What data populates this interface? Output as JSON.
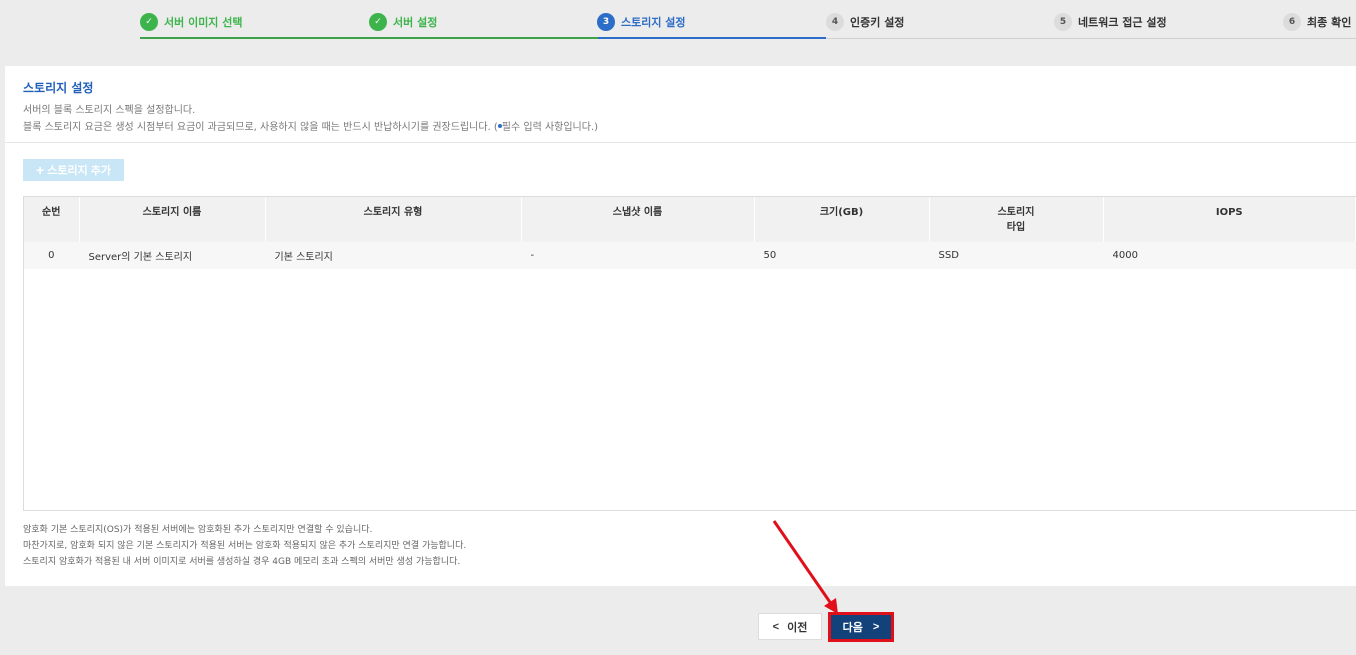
{
  "stepper": {
    "steps": [
      {
        "num": "✓",
        "label": "서버 이미지 선택",
        "state": "done"
      },
      {
        "num": "✓",
        "label": "서버 설정",
        "state": "done"
      },
      {
        "num": "3",
        "label": "스토리지 설정",
        "state": "current"
      },
      {
        "num": "4",
        "label": "인증키 설정",
        "state": "todo"
      },
      {
        "num": "5",
        "label": "네트워크 접근 설정",
        "state": "todo"
      },
      {
        "num": "6",
        "label": "최종 확인",
        "state": "todo"
      }
    ]
  },
  "panel": {
    "title": "스토리지 설정",
    "desc1": "서버의 블록 스토리지 스펙을 설정합니다.",
    "desc2_pre": "블록 스토리지 요금은 생성 시점부터 요금이 과금되므로, 사용하지 않을 때는 반드시 반납하시기를 권장드립니다. (",
    "desc2_post": "필수 입력 사항입니다.)"
  },
  "toolbar": {
    "add_label": "스토리지 추가",
    "add_icon": "plus-icon"
  },
  "table": {
    "headers": [
      "순번",
      "스토리지 이름",
      "스토리지 유형",
      "스냅샷 이름",
      "크기(GB)",
      "스토리지",
      "타입",
      "IOPS"
    ],
    "rows": [
      {
        "no": "0",
        "name": "Server의 기본 스토리지",
        "type": "기본 스토리지",
        "snapshot": "-",
        "size": "50",
        "disk": "SSD",
        "iops": "4000"
      }
    ]
  },
  "notes": [
    "암호화 기본 스토리지(OS)가 적용된 서버에는 암호화된 추가 스토리지만 연결할 수 있습니다.",
    "마찬가지로, 암호화 되지 않은 기본 스토리지가 적용된 서버는 암호화 적용되지 않은 추가 스토리지만 연결 가능합니다.",
    "스토리지 암호화가 적용된 내 서버 이미지로 서버를 생성하실 경우 4GB 메모리 초과 스펙의 서버만 생성 가능합니다."
  ],
  "footer": {
    "prev_label": "이전",
    "next_label": "다음"
  },
  "colors": {
    "accent": "#2b6dc7",
    "done": "#3cb44b",
    "next_bg": "#13427a",
    "highlight": "#e0101a"
  }
}
